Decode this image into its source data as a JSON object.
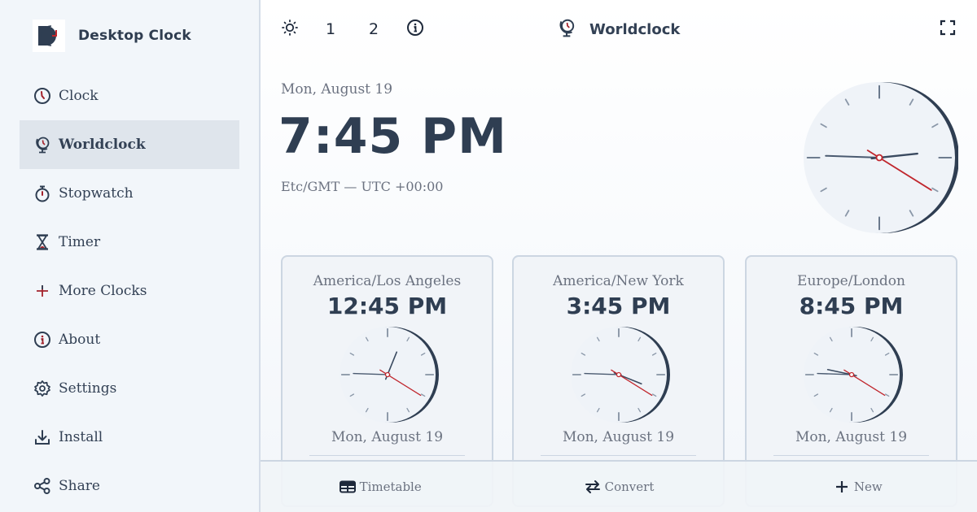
{
  "app": {
    "name": "Desktop Clock"
  },
  "sidebar": {
    "items": [
      {
        "label": "Clock",
        "icon": "clock-icon",
        "active": false
      },
      {
        "label": "Worldclock",
        "icon": "worldclock-icon",
        "active": true
      },
      {
        "label": "Stopwatch",
        "icon": "stopwatch-icon",
        "active": false
      },
      {
        "label": "Timer",
        "icon": "hourglass-icon",
        "active": false
      },
      {
        "label": "More Clocks",
        "icon": "plus-icon",
        "active": false
      },
      {
        "label": "About",
        "icon": "info-icon",
        "active": false
      },
      {
        "label": "Settings",
        "icon": "gear-icon",
        "active": false
      },
      {
        "label": "Install",
        "icon": "download-icon",
        "active": false
      },
      {
        "label": "Share",
        "icon": "share-icon",
        "active": false
      }
    ]
  },
  "toolbar": {
    "theme_icon": "sun-icon",
    "layout_1": "1",
    "layout_2": "2",
    "info_icon": "info-icon",
    "title": "Worldclock",
    "fullscreen_icon": "fullscreen-icon"
  },
  "main_clock": {
    "date": "Mon, August 19",
    "time": "7:45 PM",
    "timezone": "Etc/GMT — UTC +00:00",
    "hands_deg": {
      "hour": 84,
      "minute": -88,
      "second": 122
    }
  },
  "world_clocks": [
    {
      "city": "America/Los Angeles",
      "time": "12:45 PM",
      "date": "Mon, August 19",
      "hands_deg": {
        "hour": 22,
        "minute": -88,
        "second": 122
      }
    },
    {
      "city": "America/New York",
      "time": "3:45 PM",
      "date": "Mon, August 19",
      "hands_deg": {
        "hour": 112,
        "minute": -88,
        "second": 122
      }
    },
    {
      "city": "Europe/London",
      "time": "8:45 PM",
      "date": "Mon, August 19",
      "hands_deg": {
        "hour": -78,
        "minute": -88,
        "second": 122
      }
    }
  ],
  "bottombar": {
    "items": [
      {
        "label": "Timetable",
        "icon": "table-icon"
      },
      {
        "label": "Convert",
        "icon": "swap-icon"
      },
      {
        "label": "New",
        "icon": "plus-icon"
      }
    ]
  },
  "colors": {
    "accent": "#c0262d",
    "ink": "#2f3e52",
    "sidebar_bg": "#f2f6fa",
    "active_bg": "#dfe5ec"
  }
}
